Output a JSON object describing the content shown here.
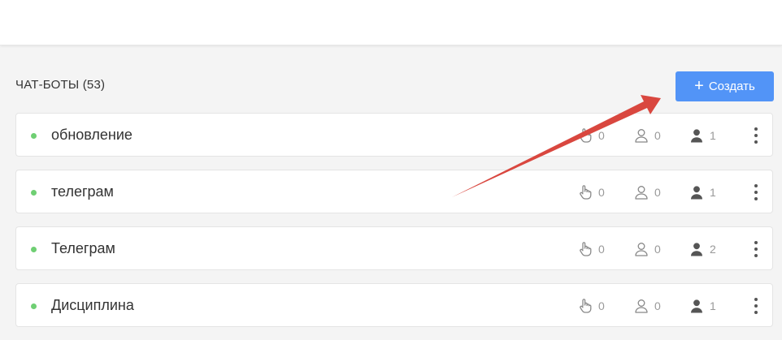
{
  "section": {
    "title": "ЧАТ-БОТЫ (53)"
  },
  "create_button": {
    "icon": "plus-icon",
    "label": "Создать"
  },
  "colors": {
    "accent": "#5294f7",
    "status_active": "#6fcf73",
    "annotation_arrow": "#d9473f"
  },
  "bots": [
    {
      "name": "обновление",
      "clicks": "0",
      "subscribers": "0",
      "admins": "1"
    },
    {
      "name": "телеграм",
      "clicks": "0",
      "subscribers": "0",
      "admins": "1"
    },
    {
      "name": "Телеграм",
      "clicks": "0",
      "subscribers": "0",
      "admins": "2"
    },
    {
      "name": "Дисциплина",
      "clicks": "0",
      "subscribers": "0",
      "admins": "1"
    }
  ]
}
